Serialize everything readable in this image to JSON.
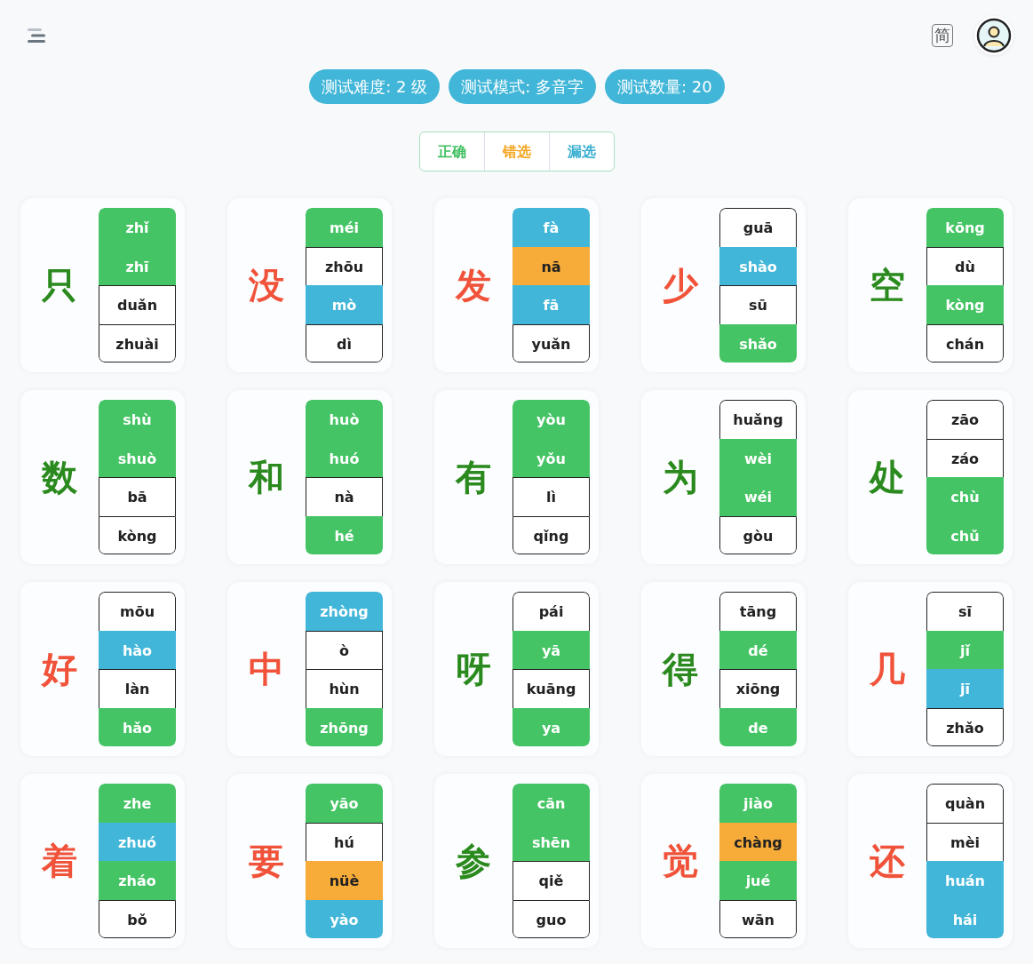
{
  "header": {
    "language_toggle": "简"
  },
  "badges": [
    "测试难度: 2 级",
    "测试模式: 多音字",
    "测试数量: 20"
  ],
  "legend": [
    {
      "label": "正确",
      "kind": "correct"
    },
    {
      "label": "错选",
      "kind": "wrong"
    },
    {
      "label": "漏选",
      "kind": "missed"
    }
  ],
  "cards": [
    {
      "char": "只",
      "correct": true,
      "options": [
        {
          "text": "zhǐ",
          "kind": "correct"
        },
        {
          "text": "zhī",
          "kind": "correct"
        },
        {
          "text": "duǎn",
          "kind": "none"
        },
        {
          "text": "zhuài",
          "kind": "none"
        }
      ]
    },
    {
      "char": "没",
      "correct": false,
      "options": [
        {
          "text": "méi",
          "kind": "correct"
        },
        {
          "text": "zhōu",
          "kind": "none"
        },
        {
          "text": "mò",
          "kind": "missed"
        },
        {
          "text": "dì",
          "kind": "none"
        }
      ]
    },
    {
      "char": "发",
      "correct": false,
      "options": [
        {
          "text": "fà",
          "kind": "missed"
        },
        {
          "text": "nā",
          "kind": "wrong"
        },
        {
          "text": "fā",
          "kind": "missed"
        },
        {
          "text": "yuǎn",
          "kind": "none"
        }
      ]
    },
    {
      "char": "少",
      "correct": false,
      "options": [
        {
          "text": "guā",
          "kind": "none"
        },
        {
          "text": "shào",
          "kind": "missed"
        },
        {
          "text": "sū",
          "kind": "none"
        },
        {
          "text": "shǎo",
          "kind": "correct"
        }
      ]
    },
    {
      "char": "空",
      "correct": true,
      "options": [
        {
          "text": "kōng",
          "kind": "correct"
        },
        {
          "text": "dù",
          "kind": "none"
        },
        {
          "text": "kòng",
          "kind": "correct"
        },
        {
          "text": "chán",
          "kind": "none"
        }
      ]
    },
    {
      "char": "数",
      "correct": true,
      "options": [
        {
          "text": "shù",
          "kind": "correct"
        },
        {
          "text": "shuò",
          "kind": "correct"
        },
        {
          "text": "bā",
          "kind": "none"
        },
        {
          "text": "kòng",
          "kind": "none"
        }
      ]
    },
    {
      "char": "和",
      "correct": true,
      "options": [
        {
          "text": "huò",
          "kind": "correct"
        },
        {
          "text": "huó",
          "kind": "correct"
        },
        {
          "text": "nà",
          "kind": "none"
        },
        {
          "text": "hé",
          "kind": "correct"
        }
      ]
    },
    {
      "char": "有",
      "correct": true,
      "options": [
        {
          "text": "yòu",
          "kind": "correct"
        },
        {
          "text": "yǒu",
          "kind": "correct"
        },
        {
          "text": "lì",
          "kind": "none"
        },
        {
          "text": "qǐng",
          "kind": "none"
        }
      ]
    },
    {
      "char": "为",
      "correct": true,
      "options": [
        {
          "text": "huǎng",
          "kind": "none"
        },
        {
          "text": "wèi",
          "kind": "correct"
        },
        {
          "text": "wéi",
          "kind": "correct"
        },
        {
          "text": "gòu",
          "kind": "none"
        }
      ]
    },
    {
      "char": "处",
      "correct": true,
      "options": [
        {
          "text": "zāo",
          "kind": "none"
        },
        {
          "text": "záo",
          "kind": "none"
        },
        {
          "text": "chù",
          "kind": "correct"
        },
        {
          "text": "chǔ",
          "kind": "correct"
        }
      ]
    },
    {
      "char": "好",
      "correct": false,
      "options": [
        {
          "text": "mōu",
          "kind": "none"
        },
        {
          "text": "hào",
          "kind": "missed"
        },
        {
          "text": "làn",
          "kind": "none"
        },
        {
          "text": "hǎo",
          "kind": "correct"
        }
      ]
    },
    {
      "char": "中",
      "correct": false,
      "options": [
        {
          "text": "zhòng",
          "kind": "missed"
        },
        {
          "text": "ò",
          "kind": "none"
        },
        {
          "text": "hùn",
          "kind": "none"
        },
        {
          "text": "zhōng",
          "kind": "correct"
        }
      ]
    },
    {
      "char": "呀",
      "correct": true,
      "options": [
        {
          "text": "pái",
          "kind": "none"
        },
        {
          "text": "yā",
          "kind": "correct"
        },
        {
          "text": "kuāng",
          "kind": "none"
        },
        {
          "text": "ya",
          "kind": "correct"
        }
      ]
    },
    {
      "char": "得",
      "correct": true,
      "options": [
        {
          "text": "tāng",
          "kind": "none"
        },
        {
          "text": "dé",
          "kind": "correct"
        },
        {
          "text": "xiōng",
          "kind": "none"
        },
        {
          "text": "de",
          "kind": "correct"
        }
      ]
    },
    {
      "char": "几",
      "correct": false,
      "options": [
        {
          "text": "sī",
          "kind": "none"
        },
        {
          "text": "jǐ",
          "kind": "correct"
        },
        {
          "text": "jī",
          "kind": "missed"
        },
        {
          "text": "zhǎo",
          "kind": "none"
        }
      ]
    },
    {
      "char": "着",
      "correct": false,
      "options": [
        {
          "text": "zhe",
          "kind": "correct"
        },
        {
          "text": "zhuó",
          "kind": "missed"
        },
        {
          "text": "zháo",
          "kind": "correct"
        },
        {
          "text": "bǒ",
          "kind": "none"
        }
      ]
    },
    {
      "char": "要",
      "correct": false,
      "options": [
        {
          "text": "yāo",
          "kind": "correct"
        },
        {
          "text": "hú",
          "kind": "none"
        },
        {
          "text": "nüè",
          "kind": "wrong"
        },
        {
          "text": "yào",
          "kind": "missed"
        }
      ]
    },
    {
      "char": "参",
      "correct": true,
      "options": [
        {
          "text": "cān",
          "kind": "correct"
        },
        {
          "text": "shēn",
          "kind": "correct"
        },
        {
          "text": "qiě",
          "kind": "none"
        },
        {
          "text": "guo",
          "kind": "none"
        }
      ]
    },
    {
      "char": "觉",
      "correct": false,
      "options": [
        {
          "text": "jiào",
          "kind": "correct"
        },
        {
          "text": "chàng",
          "kind": "wrong"
        },
        {
          "text": "jué",
          "kind": "correct"
        },
        {
          "text": "wān",
          "kind": "none"
        }
      ]
    },
    {
      "char": "还",
      "correct": false,
      "options": [
        {
          "text": "quàn",
          "kind": "none"
        },
        {
          "text": "mèi",
          "kind": "none"
        },
        {
          "text": "huán",
          "kind": "missed"
        },
        {
          "text": "hái",
          "kind": "missed"
        }
      ]
    }
  ]
}
